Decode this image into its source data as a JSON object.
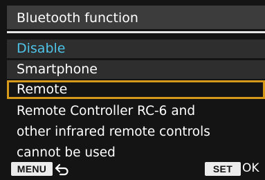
{
  "menu": {
    "title": "Bluetooth function",
    "options": [
      {
        "label": "Disable",
        "state": "current"
      },
      {
        "label": "Smartphone",
        "state": "normal"
      },
      {
        "label": "Remote",
        "state": "selected"
      }
    ],
    "description_lines": [
      "Remote Controller RC-6 and",
      "other infrared remote controls",
      "cannot be used"
    ]
  },
  "footer": {
    "menu_key": "MENU",
    "back_icon": "return-arrow-icon",
    "set_key": "SET",
    "ok_label": "OK"
  },
  "colors": {
    "background": "#141414",
    "title_bar": "#3c3c3c",
    "option_bg": "#2e2e2e",
    "current_option_text": "#4fc4e8",
    "selection_frame": "#d59a1a"
  }
}
